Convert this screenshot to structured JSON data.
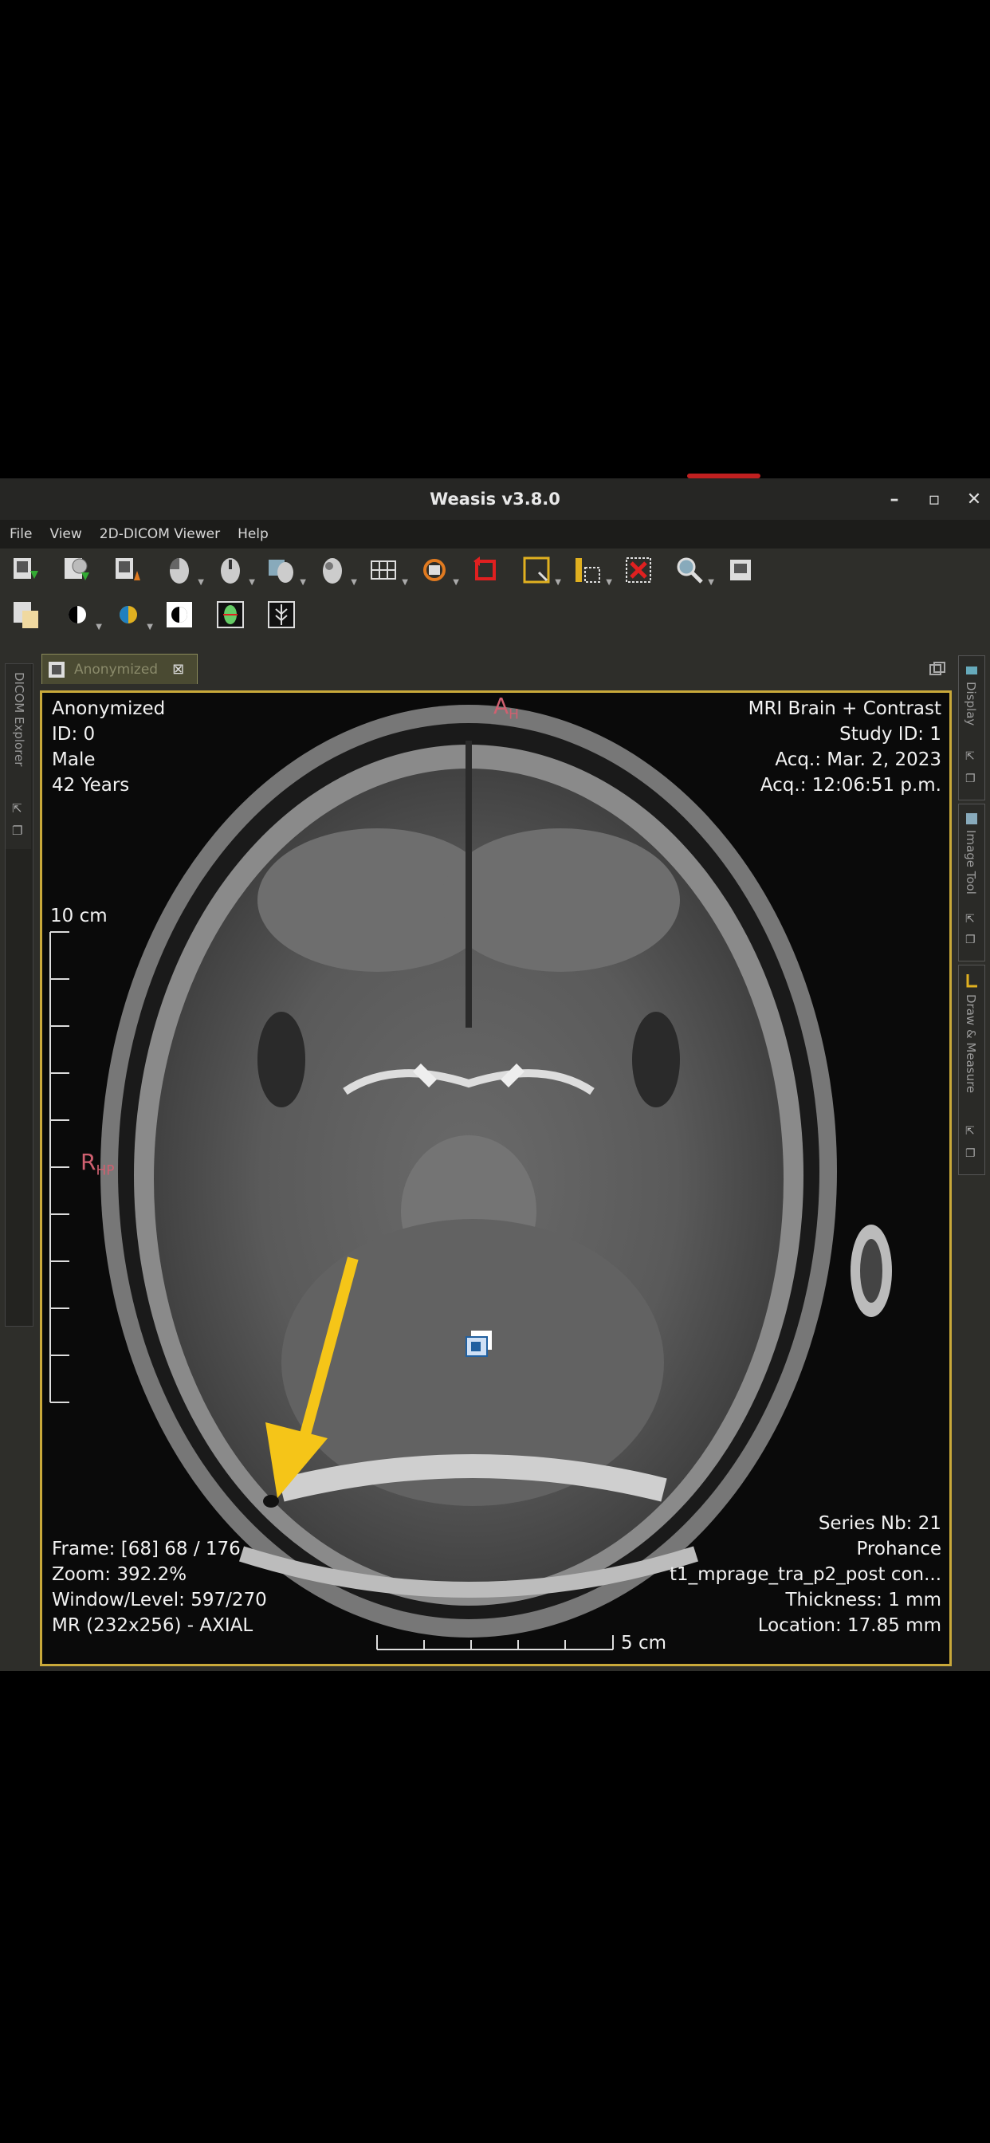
{
  "window": {
    "title": "Weasis v3.8.0"
  },
  "menu": [
    "File",
    "View",
    "2D-DICOM Viewer",
    "Help"
  ],
  "toolbar_row1": [
    "import-dicom-icon",
    "import-cd-icon",
    "export-dicom-icon",
    "mouse-left-action-icon",
    "mouse-middle-action-icon",
    "mouse-right-action-icon",
    "mouse-wheel-action-icon",
    "layout-grid-icon",
    "synchronize-icon",
    "reset-icon",
    "crosshair-icon",
    "measure-icon",
    "delete-icon",
    "zoom-icon",
    "print-icon"
  ],
  "toolbar_row2": [
    "open-report-icon",
    "window-level-icon",
    "lut-icon",
    "invert-icon",
    "rotate-icon",
    "mip-icon"
  ],
  "tab": {
    "label": "Anonymized"
  },
  "side_tabs": {
    "left": "DICOM Explorer",
    "right": [
      "Display",
      "Image Tool",
      "Draw & Measure"
    ]
  },
  "patient": {
    "name": "Anonymized",
    "id": "ID: 0",
    "sex": "Male",
    "age": "42 Years"
  },
  "study": {
    "description": "MRI Brain + Contrast",
    "study_id": "Study ID: 1",
    "acq_date": "Acq.: Mar. 2, 2023",
    "acq_time": "Acq.: 12:06:51 p.m."
  },
  "orientation": {
    "top": "A",
    "top_sub": "H",
    "left": "R",
    "left_sub": "HP"
  },
  "scale": {
    "vertical": "10 cm",
    "horizontal": "5 cm"
  },
  "frame_info": {
    "frame": "Frame: [68] 68 / 176",
    "zoom": "Zoom: 392.2%",
    "window_level": "Window/Level: 597/270",
    "modality": "MR (232x256) - AXIAL"
  },
  "series_info": {
    "series": "Series Nb: 21",
    "contrast": "Prohance",
    "protocol": "t1_mprage_tra_p2_post con...",
    "thickness": "Thickness: 1 mm",
    "location": "Location: 17.85 mm"
  },
  "colors": {
    "accent_border": "#c9a93a",
    "arrow": "#f5c518",
    "orientation": "#d06070"
  }
}
